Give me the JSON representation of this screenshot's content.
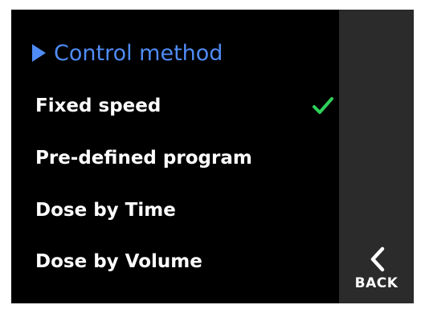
{
  "menu": {
    "title": "Control method",
    "items": [
      {
        "label": "Fixed speed",
        "selected": true
      },
      {
        "label": "Pre-defined program",
        "selected": false
      },
      {
        "label": "Dose by Time",
        "selected": false
      },
      {
        "label": "Dose by Volume",
        "selected": false
      }
    ]
  },
  "side": {
    "back_label": "BACK"
  },
  "colors": {
    "accent": "#4f8cf6",
    "check": "#2ed15a",
    "background": "#000000",
    "sidebar": "#2b2b2b",
    "text": "#ffffff"
  }
}
